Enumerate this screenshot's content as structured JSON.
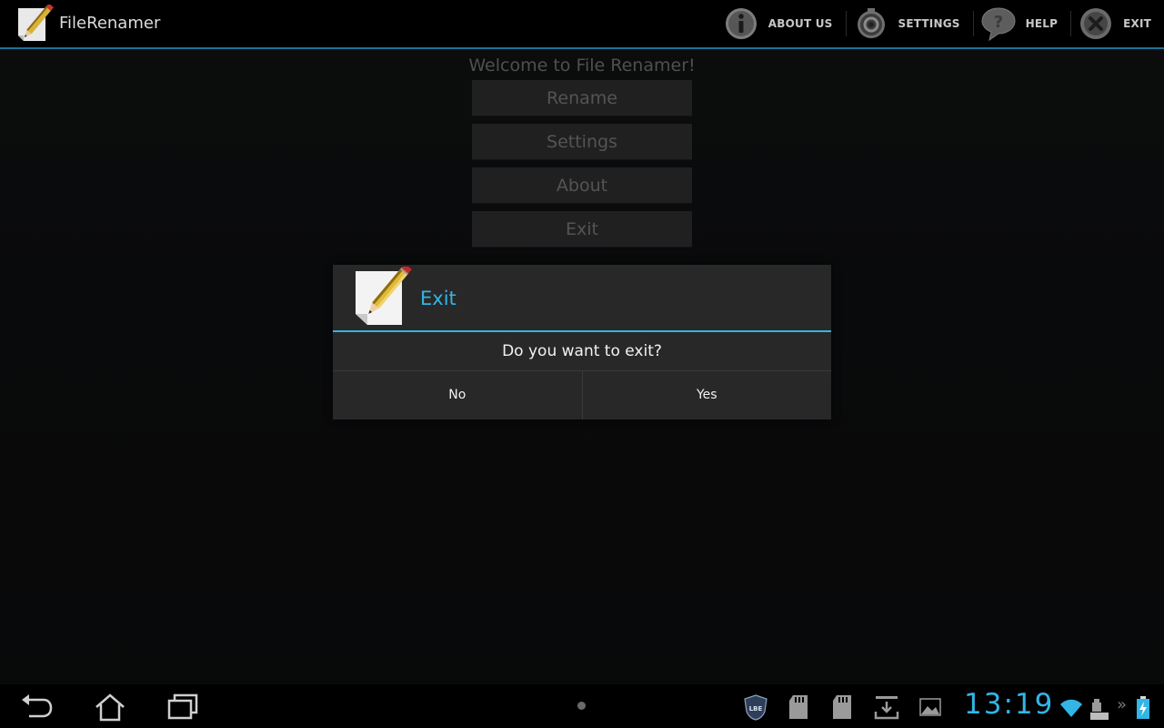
{
  "app": {
    "title": "FileRenamer"
  },
  "action_bar": {
    "items": [
      {
        "label": "ABOUT US",
        "icon": "info-icon"
      },
      {
        "label": "SETTINGS",
        "icon": "gear-icon"
      },
      {
        "label": "HELP",
        "icon": "help-bubble-icon"
      },
      {
        "label": "EXIT",
        "icon": "close-circle-icon"
      }
    ]
  },
  "main": {
    "welcome": "Welcome to File Renamer!",
    "buttons": [
      "Rename",
      "Settings",
      "About",
      "Exit"
    ]
  },
  "dialog": {
    "title": "Exit",
    "message": "Do you want to exit?",
    "negative": "No",
    "positive": "Yes"
  },
  "system_bar": {
    "clock": "13:19",
    "tray_icons": [
      "lbe-shield-icon",
      "sd-card-icon",
      "sd-card-icon",
      "download-icon",
      "image-icon",
      "wifi-icon",
      "keyboard-icon",
      "battery-icon"
    ]
  },
  "colors": {
    "accent": "#33b5e5",
    "action_divider": "#1f6f95",
    "menu_button": "#2b2b2b",
    "dialog_bg": "#282828"
  }
}
